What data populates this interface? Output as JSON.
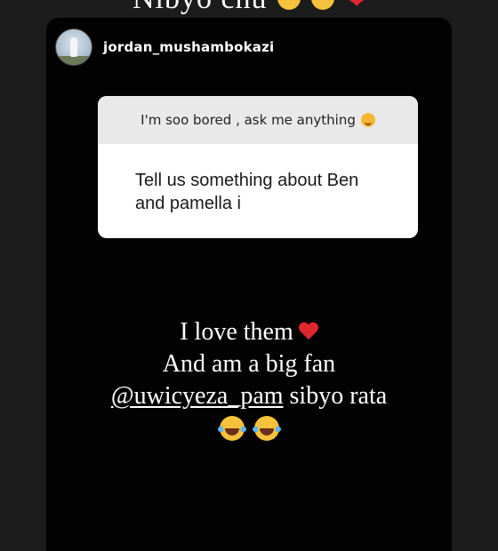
{
  "top_caption": {
    "text": "Nibyo chu",
    "emoji": [
      "laughing-face-icon",
      "laughing-face-icon",
      "red-heart-icon"
    ]
  },
  "story": {
    "username": "jordan_mushambokazi",
    "question_card": {
      "prompt": "I'm soo bored , ask me anything",
      "prompt_emoji": "upside-down-face-icon",
      "question": "Tell us something about Ben and pamella i"
    },
    "reply": {
      "line1": "I love them",
      "line1_emoji": "red-heart-icon",
      "line2": "And am a big fan",
      "mention": "@uwicyeza_pam",
      "line3_rest": " sibyo rata",
      "line4_emoji": [
        "tears-of-joy-icon",
        "tears-of-joy-icon"
      ]
    }
  },
  "colors": {
    "background": "#1c1c1c",
    "story_bg": "#020202",
    "card_header_bg": "#e9e9e9",
    "heart": "#e0262f",
    "emoji_yellow": "#f6c23b"
  }
}
